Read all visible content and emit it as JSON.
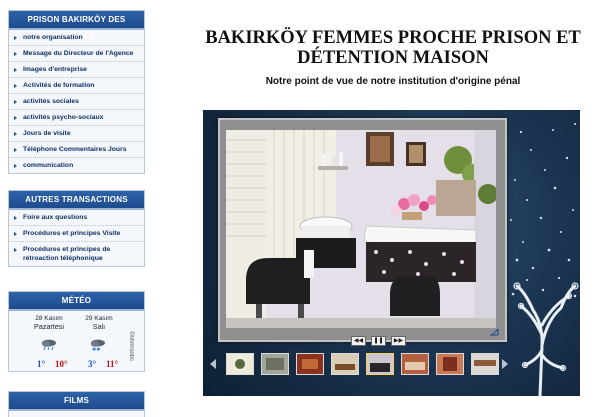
{
  "sidebar": {
    "main_menu": {
      "title": "PRISON BAKIRKÖY DES FEMMES",
      "items": [
        "notre organisation",
        "Message du Directeur de l'Agence",
        "Images d'entreprise",
        "Activités de formation",
        "activités sociales",
        "activités psycho-sociaux",
        "Jours de visite",
        "Téléphone Commentaires Jours",
        "communication"
      ]
    },
    "transactions": {
      "title": "AUTRES TRANSACTIONS",
      "items": [
        "Foire aux questions",
        "Procédures et principes Visite",
        "Procédures et principes de rétroaction téléphonique"
      ]
    },
    "weather": {
      "title": "MÉTÉO",
      "days": [
        {
          "date": "28 Kasım",
          "name": "Pazartesi",
          "low": "1°",
          "high": "10°"
        },
        {
          "date": "29 Kasım",
          "name": "Salı",
          "low": "3°",
          "high": "11°"
        }
      ],
      "provider": "©ntvmsnbc",
      "colors": {
        "low": "#1f4fb8",
        "high": "#c0141a"
      }
    },
    "films": {
      "title": "FILMS"
    }
  },
  "main": {
    "title": "BAKIRKÖY FEMMES PROCHE PRISON ET DÉTENTION MAISON",
    "subtitle": "Notre point de vue de notre institution d'origine pénal"
  },
  "gallery": {
    "controls": {
      "prev": "◀◀",
      "pause": "❚❚",
      "next": "▶▶"
    },
    "thumbnail_count": 8,
    "active_thumbnail": 5
  }
}
